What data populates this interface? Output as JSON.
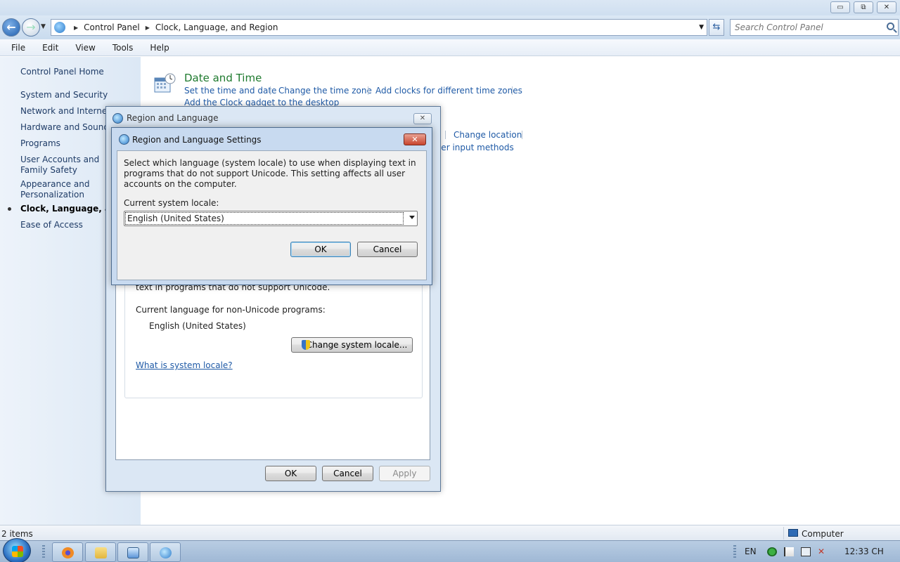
{
  "window": {
    "minimize_glyph": "▭",
    "restore_glyph": "⧉",
    "close_glyph": "✕"
  },
  "address": {
    "crumbs": [
      "Control Panel",
      "Clock, Language, and Region"
    ],
    "search_placeholder": "Search Control Panel"
  },
  "menu": [
    "File",
    "Edit",
    "View",
    "Tools",
    "Help"
  ],
  "sidebar": {
    "home": "Control Panel Home",
    "items": [
      "System and Security",
      "Network and Internet",
      "Hardware and Sound",
      "Programs",
      "User Accounts and Family Safety",
      "Appearance and Personalization",
      "Clock, Language, and Region",
      "Ease of Access"
    ]
  },
  "main": {
    "date_time_title": "Date and Time",
    "links": {
      "set_time": "Set the time and date",
      "change_zone": "Change the time zone",
      "add_clocks": "Add clocks for different time zones",
      "add_gadget": "Add the Clock gadget to the desktop",
      "change_location": "Change location",
      "input_methods": "ther input methods"
    }
  },
  "region_dialog": {
    "title": "Region and Language",
    "partial_text": "text in programs that do not support Unicode.",
    "current_lang_label": "Current language for non-Unicode programs:",
    "current_lang_value": "English (United States)",
    "change_locale_button": "Change system locale...",
    "help_link": "What is system locale?",
    "ok": "OK",
    "cancel": "Cancel",
    "apply": "Apply"
  },
  "settings_dialog": {
    "title": "Region and Language Settings",
    "description": "Select which language (system locale) to use when displaying text in programs that do not support Unicode. This setting affects all user accounts on the computer.",
    "locale_label": "Current system locale:",
    "locale_value": "English (United States)",
    "ok": "OK",
    "cancel": "Cancel",
    "close_glyph": "✕"
  },
  "status": {
    "items": "2 items",
    "computer": "Computer"
  },
  "tray": {
    "lang": "EN",
    "clock": "12:33 CH"
  }
}
